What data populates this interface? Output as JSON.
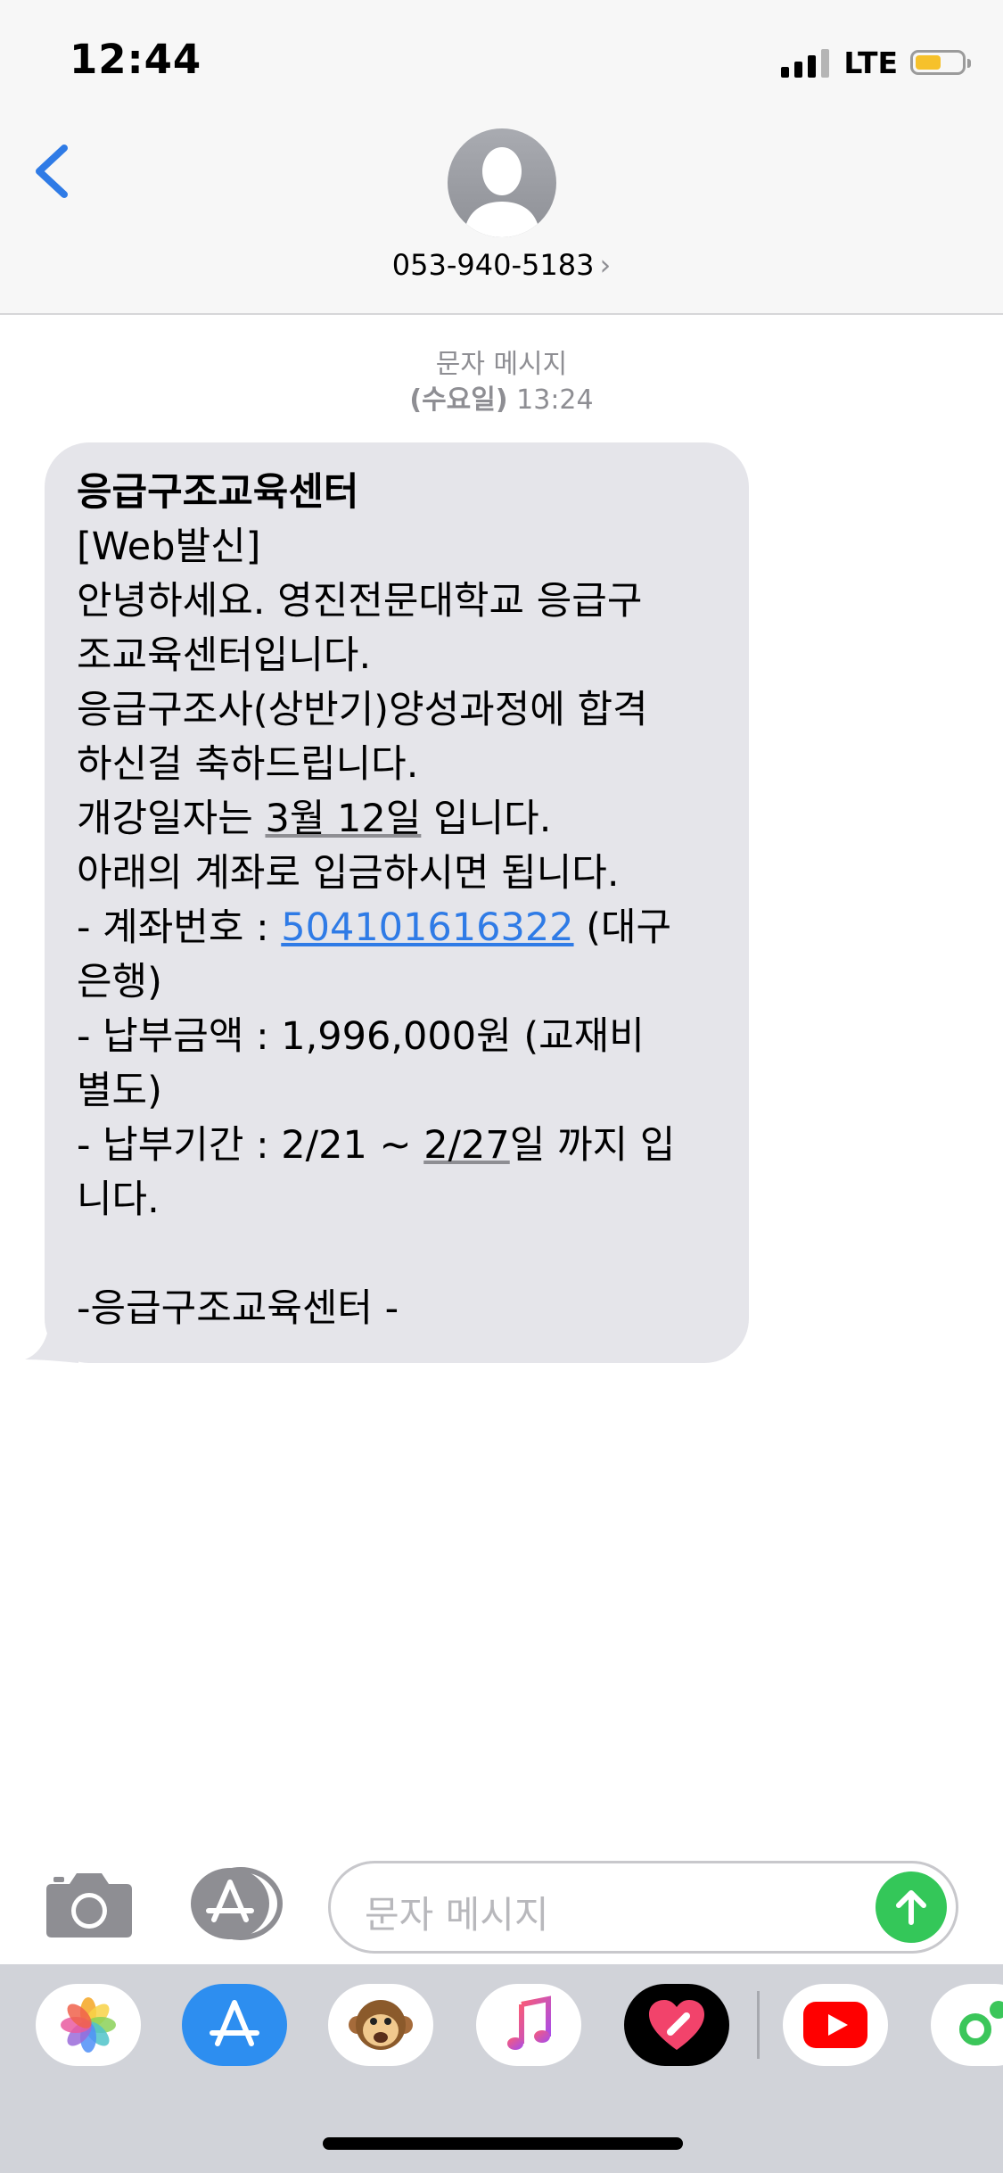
{
  "status_bar": {
    "time": "12:44",
    "network": "LTE",
    "battery_color": "#f6c12b"
  },
  "header": {
    "contact_number": "053-940-5183",
    "contact_chevron": "›",
    "back_icon": "chevron-left-icon",
    "avatar_icon": "person-silhouette-icon"
  },
  "thread": {
    "message_type": "문자 메시지",
    "timestamp_day": "(수요일)",
    "timestamp_time": " 13:24"
  },
  "message": {
    "title": "응급구조교육센터",
    "line_web": "[Web발신]",
    "line_greeting": "안녕하세요. 영진전문대학교 응급구\n조교육센터입니다.\n응급구조사(상반기)양성과정에 합격\n하신걸 축하드립니다.\n",
    "line_open_prefix": "개강일자는 ",
    "line_open_date": "3월 12일",
    "line_open_suffix": " 입니다.\n아래의 계좌로 입금하시면 됩니다.\n- 계좌번호 : ",
    "account_number": "504101616322",
    "line_after_account": " (대구\n은행)\n- 납부금액 : 1,996,000원 (교재비\n별도)\n- 납부기간 : 2/21 ~ ",
    "due_date": "2/27",
    "line_end": "일 까지 입\n니다.\n\n-응급구조교육센터 -"
  },
  "input_bar": {
    "placeholder": "문자 메시지",
    "camera_icon": "camera-icon",
    "apps_icon": "app-store-icon",
    "send_icon": "arrow-up-icon",
    "send_color": "#34c759"
  },
  "app_tray": {
    "apps": [
      "photos-icon",
      "app-store-icon",
      "animoji-icon",
      "music-icon",
      "digital-touch-icon",
      "youtube-icon",
      "partial-app-icon"
    ]
  }
}
